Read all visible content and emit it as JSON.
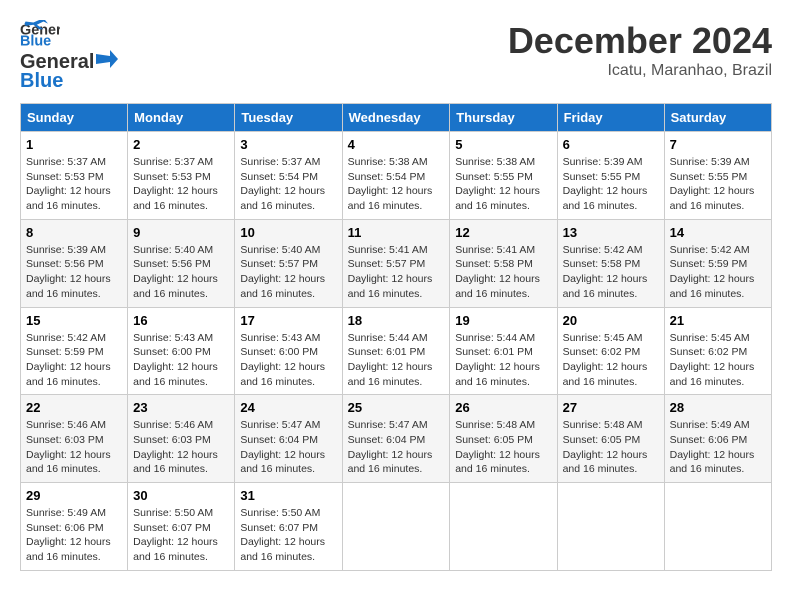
{
  "header": {
    "logo_line1": "General",
    "logo_line2": "Blue",
    "month_title": "December 2024",
    "location": "Icatu, Maranhao, Brazil"
  },
  "days_of_week": [
    "Sunday",
    "Monday",
    "Tuesday",
    "Wednesday",
    "Thursday",
    "Friday",
    "Saturday"
  ],
  "weeks": [
    [
      {
        "day": "1",
        "sunrise": "5:37 AM",
        "sunset": "5:53 PM",
        "daylight": "12 hours and 16 minutes."
      },
      {
        "day": "2",
        "sunrise": "5:37 AM",
        "sunset": "5:53 PM",
        "daylight": "12 hours and 16 minutes."
      },
      {
        "day": "3",
        "sunrise": "5:37 AM",
        "sunset": "5:54 PM",
        "daylight": "12 hours and 16 minutes."
      },
      {
        "day": "4",
        "sunrise": "5:38 AM",
        "sunset": "5:54 PM",
        "daylight": "12 hours and 16 minutes."
      },
      {
        "day": "5",
        "sunrise": "5:38 AM",
        "sunset": "5:55 PM",
        "daylight": "12 hours and 16 minutes."
      },
      {
        "day": "6",
        "sunrise": "5:39 AM",
        "sunset": "5:55 PM",
        "daylight": "12 hours and 16 minutes."
      },
      {
        "day": "7",
        "sunrise": "5:39 AM",
        "sunset": "5:55 PM",
        "daylight": "12 hours and 16 minutes."
      }
    ],
    [
      {
        "day": "8",
        "sunrise": "5:39 AM",
        "sunset": "5:56 PM",
        "daylight": "12 hours and 16 minutes."
      },
      {
        "day": "9",
        "sunrise": "5:40 AM",
        "sunset": "5:56 PM",
        "daylight": "12 hours and 16 minutes."
      },
      {
        "day": "10",
        "sunrise": "5:40 AM",
        "sunset": "5:57 PM",
        "daylight": "12 hours and 16 minutes."
      },
      {
        "day": "11",
        "sunrise": "5:41 AM",
        "sunset": "5:57 PM",
        "daylight": "12 hours and 16 minutes."
      },
      {
        "day": "12",
        "sunrise": "5:41 AM",
        "sunset": "5:58 PM",
        "daylight": "12 hours and 16 minutes."
      },
      {
        "day": "13",
        "sunrise": "5:42 AM",
        "sunset": "5:58 PM",
        "daylight": "12 hours and 16 minutes."
      },
      {
        "day": "14",
        "sunrise": "5:42 AM",
        "sunset": "5:59 PM",
        "daylight": "12 hours and 16 minutes."
      }
    ],
    [
      {
        "day": "15",
        "sunrise": "5:42 AM",
        "sunset": "5:59 PM",
        "daylight": "12 hours and 16 minutes."
      },
      {
        "day": "16",
        "sunrise": "5:43 AM",
        "sunset": "6:00 PM",
        "daylight": "12 hours and 16 minutes."
      },
      {
        "day": "17",
        "sunrise": "5:43 AM",
        "sunset": "6:00 PM",
        "daylight": "12 hours and 16 minutes."
      },
      {
        "day": "18",
        "sunrise": "5:44 AM",
        "sunset": "6:01 PM",
        "daylight": "12 hours and 16 minutes."
      },
      {
        "day": "19",
        "sunrise": "5:44 AM",
        "sunset": "6:01 PM",
        "daylight": "12 hours and 16 minutes."
      },
      {
        "day": "20",
        "sunrise": "5:45 AM",
        "sunset": "6:02 PM",
        "daylight": "12 hours and 16 minutes."
      },
      {
        "day": "21",
        "sunrise": "5:45 AM",
        "sunset": "6:02 PM",
        "daylight": "12 hours and 16 minutes."
      }
    ],
    [
      {
        "day": "22",
        "sunrise": "5:46 AM",
        "sunset": "6:03 PM",
        "daylight": "12 hours and 16 minutes."
      },
      {
        "day": "23",
        "sunrise": "5:46 AM",
        "sunset": "6:03 PM",
        "daylight": "12 hours and 16 minutes."
      },
      {
        "day": "24",
        "sunrise": "5:47 AM",
        "sunset": "6:04 PM",
        "daylight": "12 hours and 16 minutes."
      },
      {
        "day": "25",
        "sunrise": "5:47 AM",
        "sunset": "6:04 PM",
        "daylight": "12 hours and 16 minutes."
      },
      {
        "day": "26",
        "sunrise": "5:48 AM",
        "sunset": "6:05 PM",
        "daylight": "12 hours and 16 minutes."
      },
      {
        "day": "27",
        "sunrise": "5:48 AM",
        "sunset": "6:05 PM",
        "daylight": "12 hours and 16 minutes."
      },
      {
        "day": "28",
        "sunrise": "5:49 AM",
        "sunset": "6:06 PM",
        "daylight": "12 hours and 16 minutes."
      }
    ],
    [
      {
        "day": "29",
        "sunrise": "5:49 AM",
        "sunset": "6:06 PM",
        "daylight": "12 hours and 16 minutes."
      },
      {
        "day": "30",
        "sunrise": "5:50 AM",
        "sunset": "6:07 PM",
        "daylight": "12 hours and 16 minutes."
      },
      {
        "day": "31",
        "sunrise": "5:50 AM",
        "sunset": "6:07 PM",
        "daylight": "12 hours and 16 minutes."
      },
      null,
      null,
      null,
      null
    ]
  ]
}
